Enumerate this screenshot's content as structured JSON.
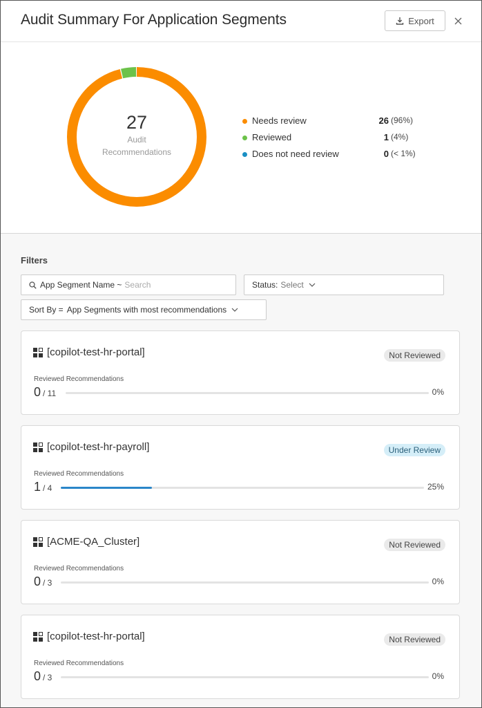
{
  "header": {
    "title": "Audit Summary For Application Segments",
    "export_label": "Export"
  },
  "summary": {
    "total": "27",
    "total_label_line1": "Audit",
    "total_label_line2": "Recommendations",
    "legend": [
      {
        "label": "Needs review",
        "count": "26",
        "pct": "(96%)",
        "color": "#fb8c00",
        "value": 26
      },
      {
        "label": "Reviewed",
        "count": "1",
        "pct": "(4%)",
        "color": "#6cc24a",
        "value": 1
      },
      {
        "label": "Does not need review",
        "count": "0",
        "pct": "(< 1%)",
        "color": "#1a8fc4",
        "value": 0
      }
    ]
  },
  "filters": {
    "title": "Filters",
    "search_label": "App Segment Name ~",
    "search_placeholder": "Search",
    "status_label": "Status:",
    "status_value": "Select",
    "sort_label": "Sort By =",
    "sort_value": "App Segments with most recommendations"
  },
  "cards": [
    {
      "name": "[copilot-test-hr-portal]",
      "status": "Not Reviewed",
      "reviewed_label": "Reviewed Recommendations",
      "reviewed": "0",
      "total": "/ 11",
      "pct": "0%",
      "fraction": 0.0
    },
    {
      "name": "[copilot-test-hr-payroll]",
      "status": "Under Review",
      "reviewed_label": "Reviewed Recommendations",
      "reviewed": "1",
      "total": "/ 4",
      "pct": "25%",
      "fraction": 0.25
    },
    {
      "name": "[ACME-QA_Cluster]",
      "status": "Not Reviewed",
      "reviewed_label": "Reviewed Recommendations",
      "reviewed": "0",
      "total": "/ 3",
      "pct": "0%",
      "fraction": 0.0
    },
    {
      "name": "[copilot-test-hr-portal]",
      "status": "Not Reviewed",
      "reviewed_label": "Reviewed Recommendations",
      "reviewed": "0",
      "total": "/ 3",
      "pct": "0%",
      "fraction": 0.0
    }
  ],
  "icons": {
    "export": "download-icon",
    "close": "close-icon",
    "search": "search-icon",
    "chevron": "chevron-down-icon",
    "segment": "app-segment-icon"
  }
}
